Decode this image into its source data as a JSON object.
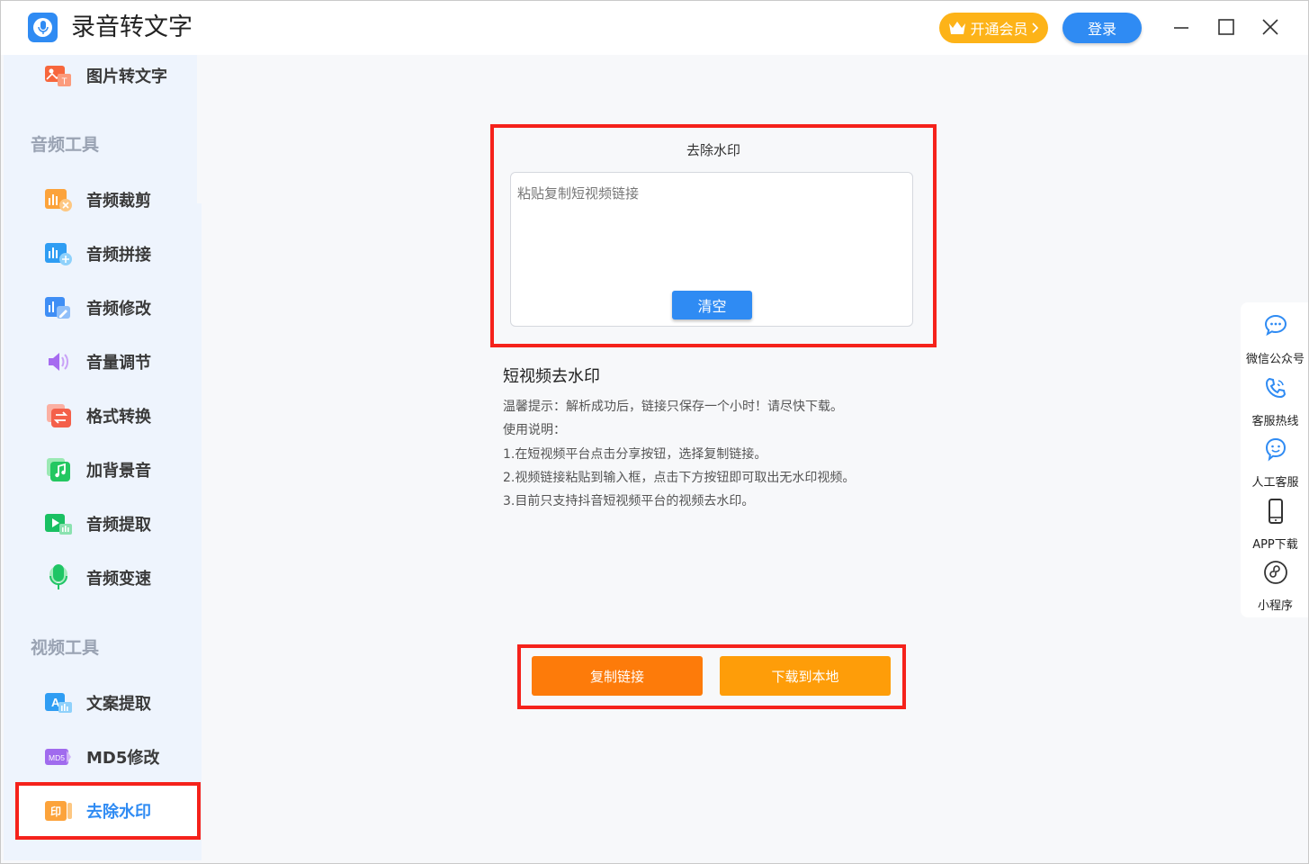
{
  "app": {
    "title": "录音转文字"
  },
  "header": {
    "vip_label": "开通会员",
    "login_label": "登录"
  },
  "sidebar": {
    "top_item": {
      "label": "图片转文字",
      "icon": "image-to-text-icon"
    },
    "audio_section": "音频工具",
    "audio_items": [
      {
        "label": "音频裁剪",
        "icon": "audio-cut-icon"
      },
      {
        "label": "音频拼接",
        "icon": "audio-merge-icon"
      },
      {
        "label": "音频修改",
        "icon": "audio-edit-icon"
      },
      {
        "label": "音量调节",
        "icon": "volume-icon"
      },
      {
        "label": "格式转换",
        "icon": "format-convert-icon"
      },
      {
        "label": "加背景音",
        "icon": "background-music-icon"
      },
      {
        "label": "音频提取",
        "icon": "audio-extract-icon"
      },
      {
        "label": "音频变速",
        "icon": "audio-speed-icon"
      }
    ],
    "video_section": "视频工具",
    "video_items": [
      {
        "label": "文案提取",
        "icon": "text-extract-icon"
      },
      {
        "label": "MD5修改",
        "icon": "md5-icon"
      },
      {
        "label": "去除水印",
        "icon": "watermark-icon"
      }
    ],
    "md5_badge": "MD5",
    "watermark_badge": "印"
  },
  "main": {
    "panel_title": "去除水印",
    "input_placeholder": "粘贴复制短视频链接",
    "input_value": "",
    "clear_label": "清空",
    "info_title": "短视频去水印",
    "info_lines": [
      "温馨提示：解析成功后，链接只保存一个小时！请尽快下载。",
      "使用说明：",
      "1.在短视频平台点击分享按钮，选择复制链接。",
      "2.视频链接粘贴到输入框，点击下方按钮即可取出无水印视频。",
      "3.目前只支持抖音短视频平台的视频去水印。"
    ],
    "copy_label": "复制链接",
    "download_label": "下载到本地"
  },
  "right_bar": {
    "items": [
      {
        "label": "微信公众号",
        "icon": "wechat-icon"
      },
      {
        "label": "客服热线",
        "icon": "phone-icon"
      },
      {
        "label": "人工客服",
        "icon": "customer-service-icon"
      },
      {
        "label": "APP下载",
        "icon": "mobile-icon"
      },
      {
        "label": "小程序",
        "icon": "mini-program-icon"
      }
    ]
  },
  "colors": {
    "accent": "#2f8bf3",
    "vip": "#fdb318",
    "highlight": "#f5221b",
    "copy": "#fd7b0a",
    "download": "#fe9d09"
  }
}
